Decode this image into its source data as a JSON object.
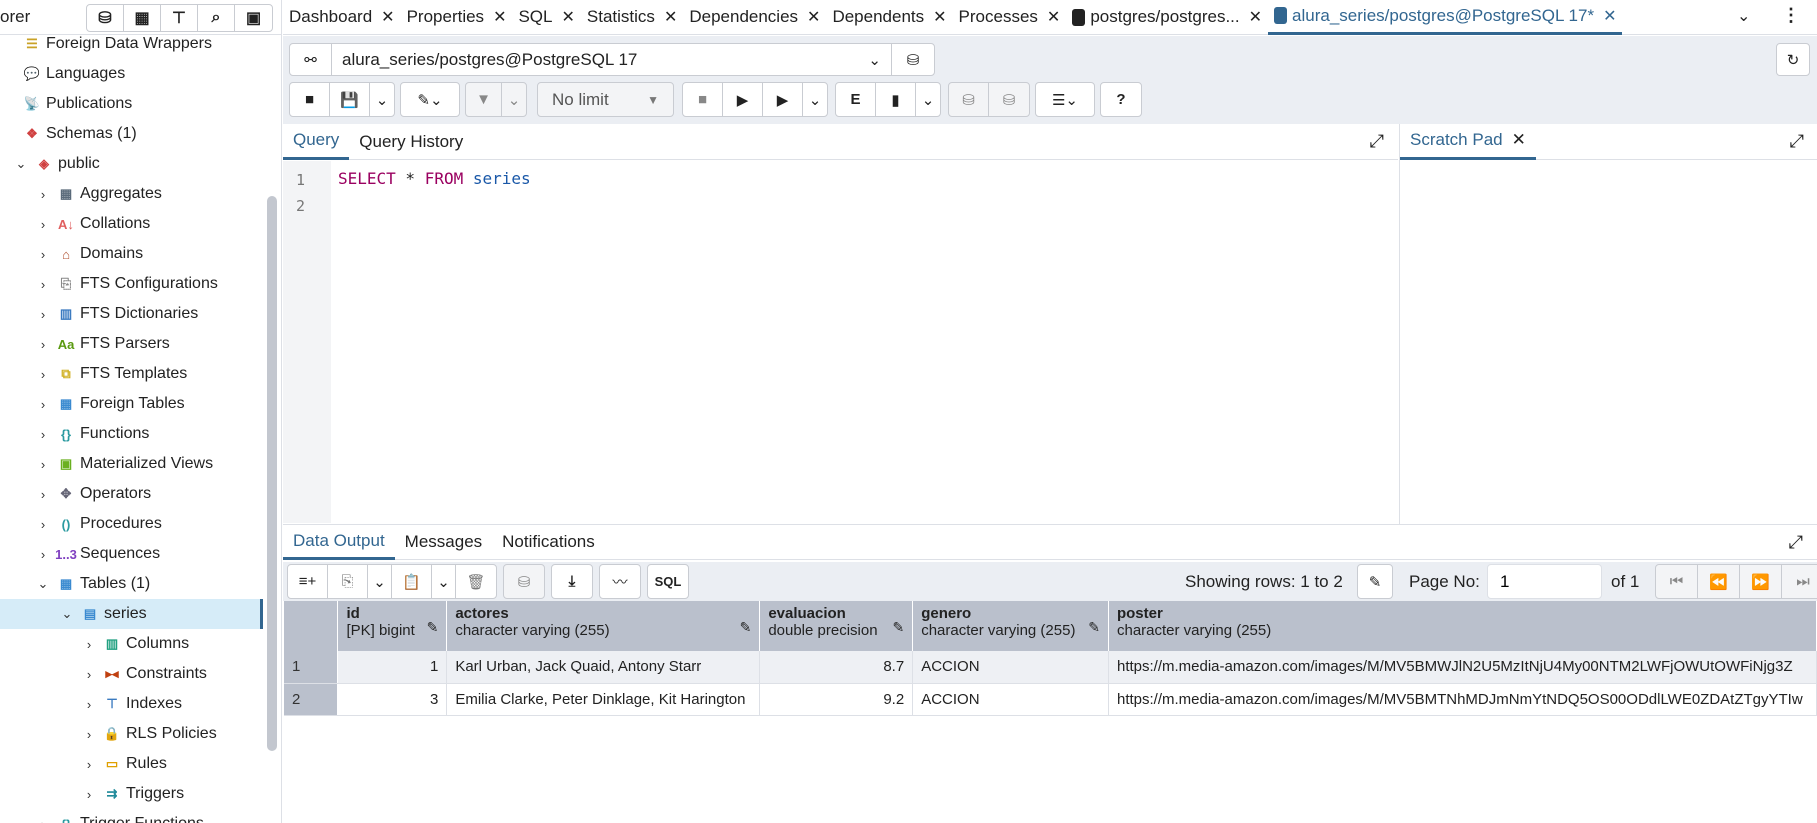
{
  "sidebar": {
    "title": "orer",
    "tools": [
      "database-icon",
      "table-icon",
      "filter-table-icon",
      "search-icon",
      "terminal-icon"
    ],
    "items": [
      {
        "label": "Foreign Data Wrappers",
        "level": 0,
        "chev": "",
        "icon": "fdw-icon",
        "glyph": "☰",
        "color": "#c9a227"
      },
      {
        "label": "Languages",
        "level": 0,
        "chev": "",
        "icon": "language-icon",
        "glyph": "💬",
        "color": "#e0b800"
      },
      {
        "label": "Publications",
        "level": 0,
        "chev": "",
        "icon": "publication-icon",
        "glyph": "📡",
        "color": "#5a6fb0"
      },
      {
        "label": "Schemas (1)",
        "level": 0,
        "chev": "",
        "icon": "schemas-icon",
        "glyph": "❖",
        "color": "#d04040"
      },
      {
        "label": "public",
        "level": 1,
        "chev": "⌄",
        "icon": "schema-icon",
        "glyph": "◈",
        "color": "#d04040"
      },
      {
        "label": "Aggregates",
        "level": 2,
        "chev": "›",
        "icon": "aggregates-icon",
        "glyph": "▦",
        "color": "#5a6a7a"
      },
      {
        "label": "Collations",
        "level": 2,
        "chev": "›",
        "icon": "collations-icon",
        "glyph": "A↓",
        "color": "#e06060"
      },
      {
        "label": "Domains",
        "level": 2,
        "chev": "›",
        "icon": "domains-icon",
        "glyph": "⌂",
        "color": "#b05030"
      },
      {
        "label": "FTS Configurations",
        "level": 2,
        "chev": "›",
        "icon": "fts-configurations-icon",
        "glyph": "⎘",
        "color": "#888"
      },
      {
        "label": "FTS Dictionaries",
        "level": 2,
        "chev": "›",
        "icon": "fts-dictionaries-icon",
        "glyph": "▥",
        "color": "#3a7ac0"
      },
      {
        "label": "FTS Parsers",
        "level": 2,
        "chev": "›",
        "icon": "fts-parsers-icon",
        "glyph": "Aa",
        "color": "#5a9a10"
      },
      {
        "label": "FTS Templates",
        "level": 2,
        "chev": "›",
        "icon": "fts-templates-icon",
        "glyph": "⧉",
        "color": "#d0b020"
      },
      {
        "label": "Foreign Tables",
        "level": 2,
        "chev": "›",
        "icon": "foreign-tables-icon",
        "glyph": "▦",
        "color": "#3a8ad0"
      },
      {
        "label": "Functions",
        "level": 2,
        "chev": "›",
        "icon": "functions-icon",
        "glyph": "{}",
        "color": "#2a9aa0"
      },
      {
        "label": "Materialized Views",
        "level": 2,
        "chev": "›",
        "icon": "materialized-views-icon",
        "glyph": "▣",
        "color": "#6ab020"
      },
      {
        "label": "Operators",
        "level": 2,
        "chev": "›",
        "icon": "operators-icon",
        "glyph": "✥",
        "color": "#667"
      },
      {
        "label": "Procedures",
        "level": 2,
        "chev": "›",
        "icon": "procedures-icon",
        "glyph": "()",
        "color": "#2a9aa0"
      },
      {
        "label": "Sequences",
        "level": 2,
        "chev": "›",
        "icon": "sequences-icon",
        "glyph": "1..3",
        "color": "#8040c0"
      },
      {
        "label": "Tables (1)",
        "level": 2,
        "chev": "⌄",
        "icon": "tables-icon",
        "glyph": "▦",
        "color": "#3a8ad0"
      },
      {
        "label": "series",
        "level": 3,
        "chev": "⌄",
        "icon": "table-icon",
        "glyph": "▤",
        "color": "#3a8ad0",
        "selected": true
      },
      {
        "label": "Columns",
        "level": 4,
        "chev": "›",
        "icon": "columns-icon",
        "glyph": "▥",
        "color": "#20a080"
      },
      {
        "label": "Constraints",
        "level": 4,
        "chev": "›",
        "icon": "constraints-icon",
        "glyph": "▸◂",
        "color": "#c04010"
      },
      {
        "label": "Indexes",
        "level": 4,
        "chev": "›",
        "icon": "indexes-icon",
        "glyph": "⊤",
        "color": "#3a7ac0"
      },
      {
        "label": "RLS Policies",
        "level": 4,
        "chev": "›",
        "icon": "rls-policies-icon",
        "glyph": "🔒",
        "color": "#4a9a20"
      },
      {
        "label": "Rules",
        "level": 4,
        "chev": "›",
        "icon": "rules-icon",
        "glyph": "▭",
        "color": "#e0a000"
      },
      {
        "label": "Triggers",
        "level": 4,
        "chev": "›",
        "icon": "triggers-icon",
        "glyph": "⇉",
        "color": "#208a9a"
      },
      {
        "label": "Trigger Functions",
        "level": 2,
        "chev": "›",
        "icon": "trigger-functions-icon",
        "glyph": "{}",
        "color": "#2a9aa0"
      }
    ]
  },
  "tabs": [
    {
      "label": "Dashboard"
    },
    {
      "label": "Properties"
    },
    {
      "label": "SQL"
    },
    {
      "label": "Statistics"
    },
    {
      "label": "Dependencies"
    },
    {
      "label": "Dependents"
    },
    {
      "label": "Processes"
    },
    {
      "label": "postgres/postgres...",
      "db": true
    },
    {
      "label": "alura_series/postgres@PostgreSQL 17*",
      "db": true,
      "active": true
    }
  ],
  "connection": "alura_series/postgres@PostgreSQL 17",
  "limit": "No limit",
  "query_tabs": [
    "Query",
    "Query History"
  ],
  "scratch_pad": "Scratch Pad",
  "editor": {
    "lines": [
      "1",
      "2"
    ],
    "kw1": "SELECT",
    "star": " * ",
    "kw2": "FROM",
    "table": " series"
  },
  "output_tabs": [
    "Data Output",
    "Messages",
    "Notifications"
  ],
  "grid_toolbar": {
    "sql": "SQL",
    "showing": "Showing rows: 1 to 2",
    "page_label": "Page No:",
    "page": "1",
    "of": "of 1"
  },
  "columns": [
    {
      "name": "id",
      "type": "[PK] bigint"
    },
    {
      "name": "actores",
      "type": "character varying (255)"
    },
    {
      "name": "evaluacion",
      "type": "double precision"
    },
    {
      "name": "genero",
      "type": "character varying (255)"
    },
    {
      "name": "poster",
      "type": "character varying (255)"
    }
  ],
  "rows": [
    {
      "n": "1",
      "id": "1",
      "actores": "Karl Urban, Jack Quaid, Antony Starr",
      "evaluacion": "8.7",
      "genero": "ACCION",
      "poster": "https://m.media-amazon.com/images/M/MV5BMWJlN2U5MzItNjU4My00NTM2LWFjOWUtOWFiNjg3Z"
    },
    {
      "n": "2",
      "id": "3",
      "actores": "Emilia Clarke, Peter Dinklage, Kit Harington",
      "evaluacion": "9.2",
      "genero": "ACCION",
      "poster": "https://m.media-amazon.com/images/M/MV5BMTNhMDJmNmYtNDQ5OS00ODdlLWE0ZDAtZTgyYTIw"
    }
  ],
  "colors": {
    "accent": "#326690",
    "header": "#bac0cc",
    "toolbar_bg": "#ebeef3",
    "selection": "#d6ecf8"
  }
}
